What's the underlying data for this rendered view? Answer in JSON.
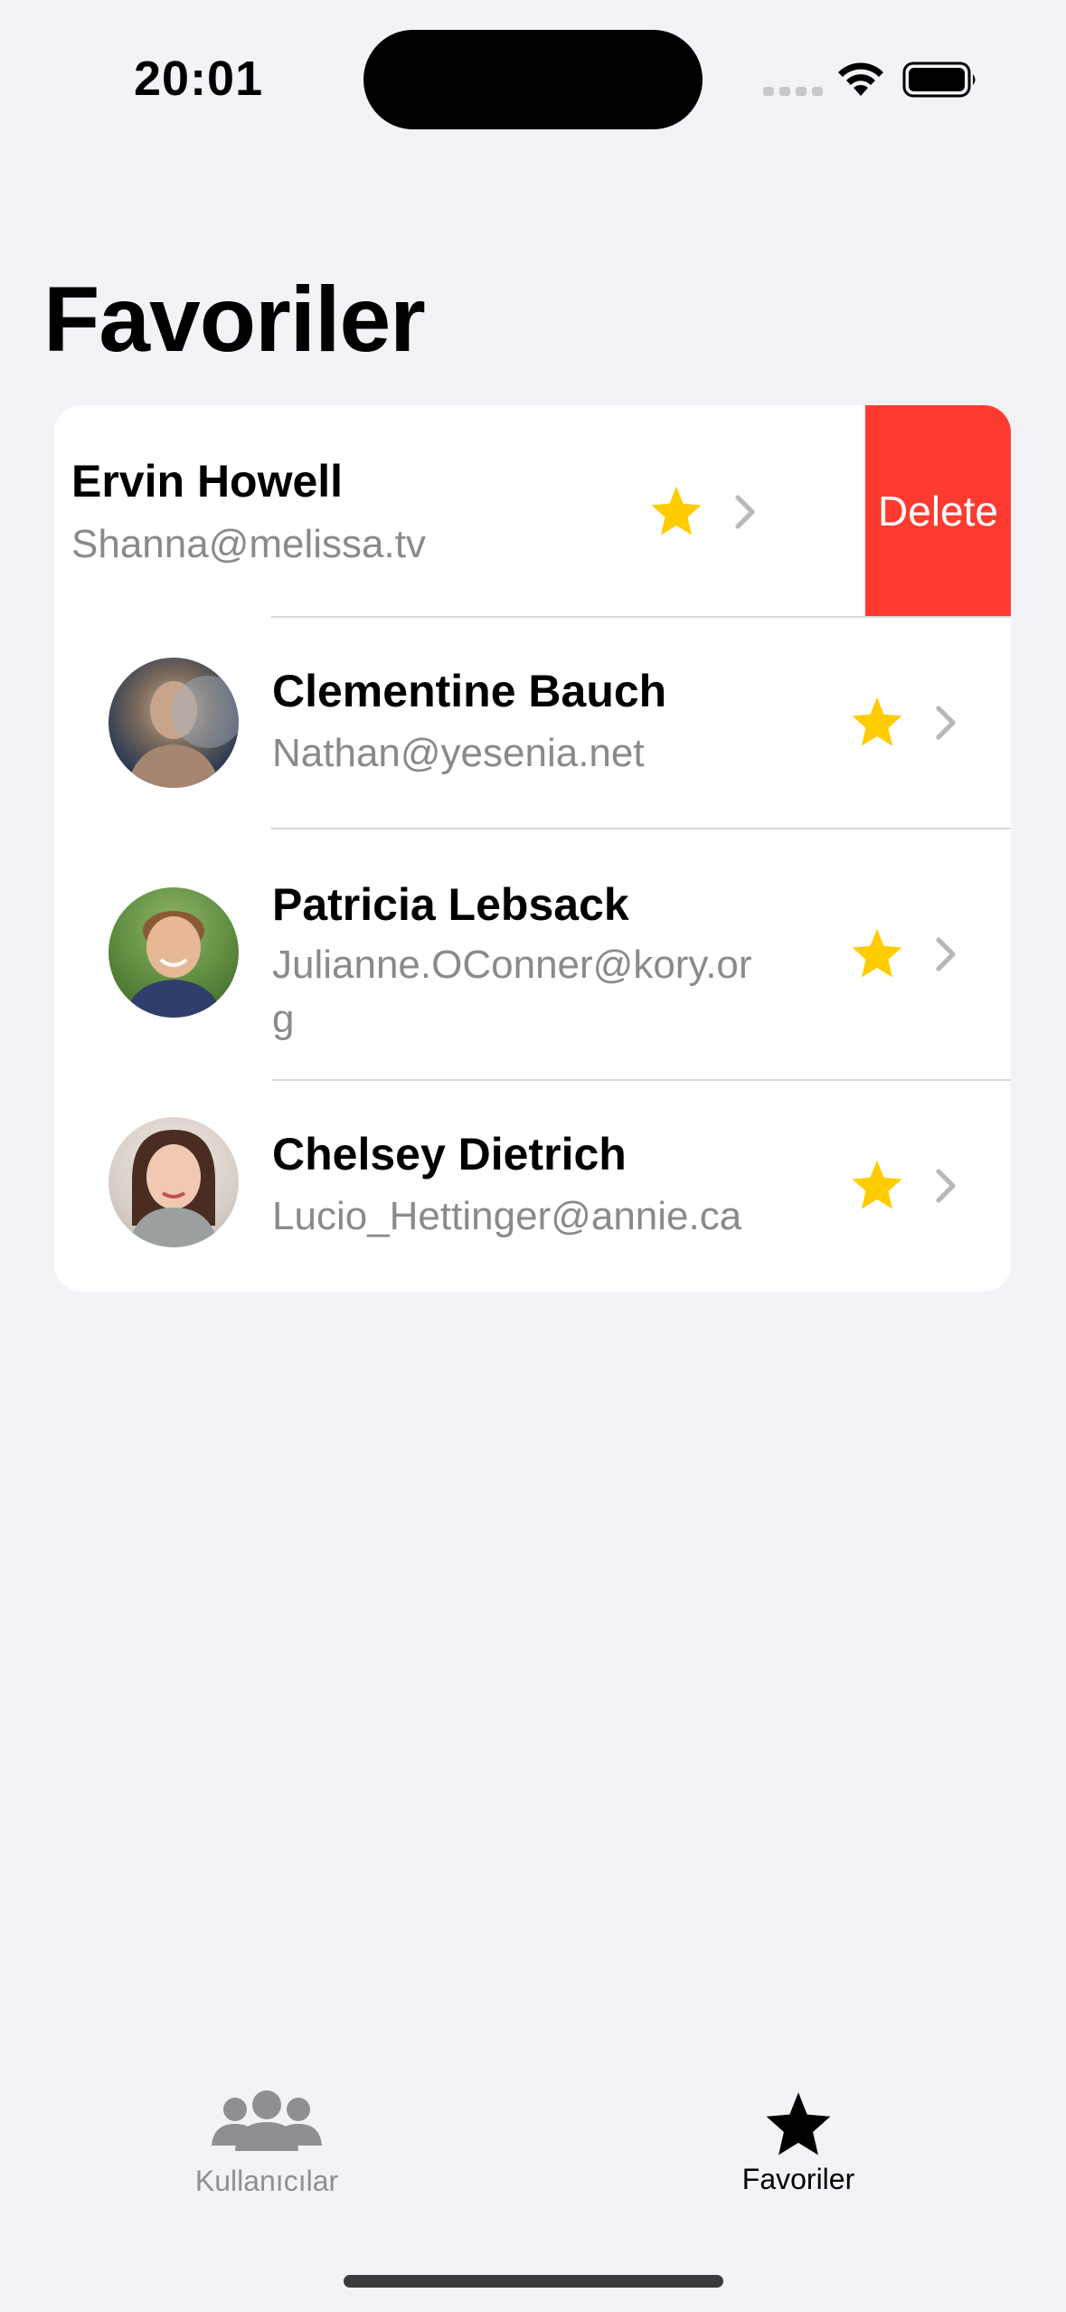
{
  "status_bar": {
    "time": "20:01"
  },
  "page": {
    "title": "Favoriler"
  },
  "favorites": [
    {
      "name": "Ervin Howell",
      "email": "Shanna@melissa.tv",
      "favorite": true,
      "swiped": true
    },
    {
      "name": "Clementine Bauch",
      "email": "Nathan@yesenia.net",
      "favorite": true
    },
    {
      "name": "Patricia Lebsack",
      "email": "Julianne.OConner@kory.org",
      "favorite": true
    },
    {
      "name": "Chelsey Dietrich",
      "email": "Lucio_Hettinger@annie.ca",
      "favorite": true
    }
  ],
  "swipe_actions": {
    "delete_label": "Delete"
  },
  "tab_bar": {
    "tabs": [
      {
        "label": "Kullanıcılar",
        "icon": "people-icon",
        "selected": false
      },
      {
        "label": "Favoriler",
        "icon": "star-icon",
        "selected": true
      }
    ]
  },
  "colors": {
    "accent_star": "#ffcc00",
    "delete": "#ff3b30",
    "background": "#f2f2f7"
  }
}
